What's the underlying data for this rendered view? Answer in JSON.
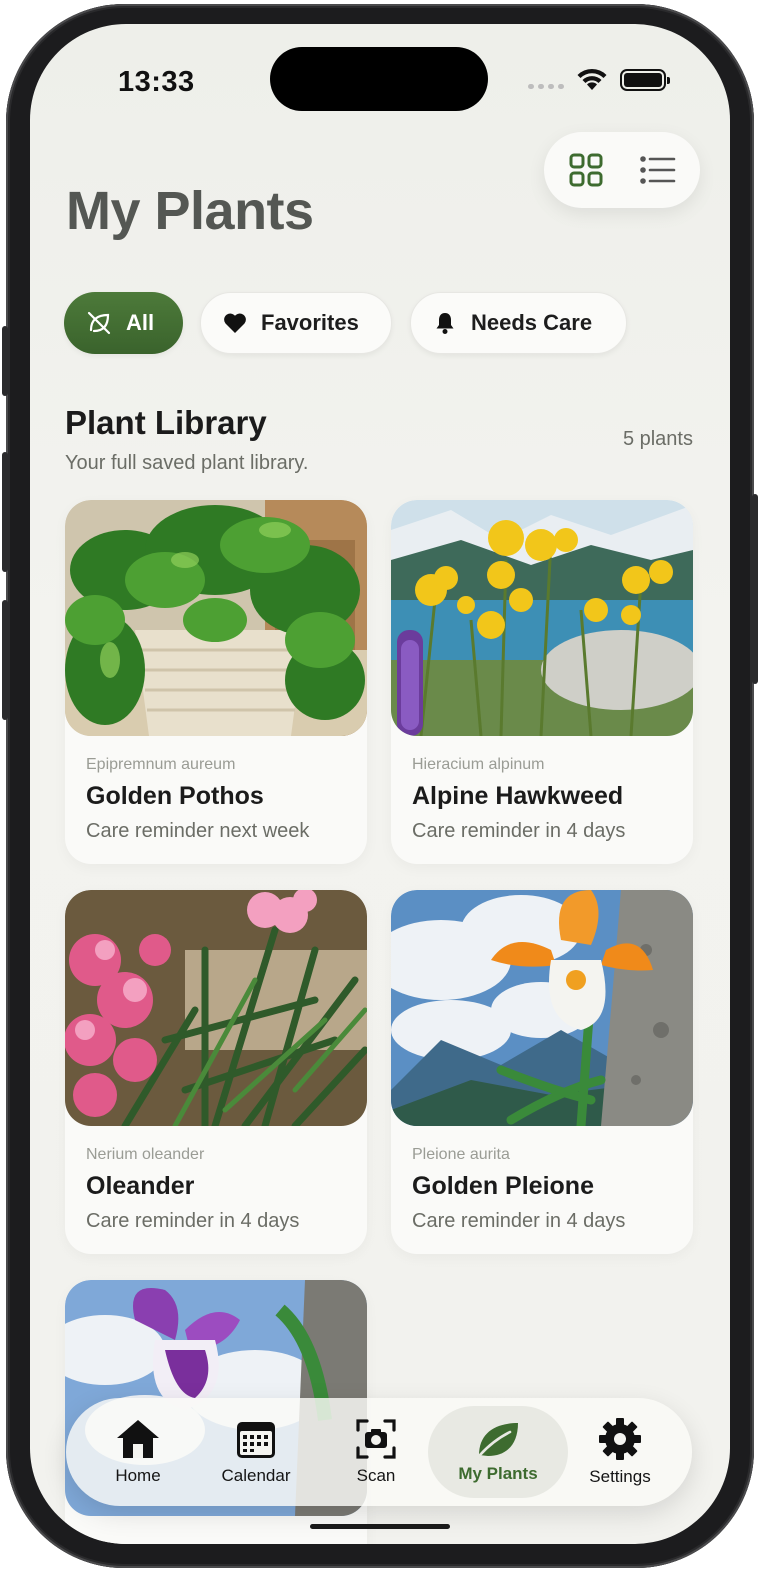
{
  "status_bar": {
    "time": "13:33"
  },
  "header": {
    "title": "My Plants"
  },
  "view_toggle": {
    "selected": "grid"
  },
  "filters": [
    {
      "label": "All",
      "icon": "leaf-slash-icon",
      "active": true
    },
    {
      "label": "Favorites",
      "icon": "heart-icon",
      "active": false
    },
    {
      "label": "Needs Care",
      "icon": "bell-icon",
      "active": false
    }
  ],
  "library": {
    "title": "Plant Library",
    "subtitle": "Your full saved plant library.",
    "count": "5 plants"
  },
  "plants": [
    {
      "scientific": "Epipremnum aureum",
      "name": "Golden Pothos",
      "reminder": "Care reminder next week"
    },
    {
      "scientific": "Hieracium alpinum",
      "name": "Alpine Hawkweed",
      "reminder": "Care reminder in 4 days"
    },
    {
      "scientific": "Nerium oleander",
      "name": "Oleander",
      "reminder": "Care reminder in 4 days"
    },
    {
      "scientific": "Pleione aurita",
      "name": "Golden Pleione",
      "reminder": "Care reminder in 4 days"
    }
  ],
  "nav": [
    {
      "label": "Home",
      "icon": "home-icon"
    },
    {
      "label": "Calendar",
      "icon": "calendar-icon"
    },
    {
      "label": "Scan",
      "icon": "camera-scan-icon"
    },
    {
      "label": "My Plants",
      "icon": "leaf-icon",
      "active": true
    },
    {
      "label": "Settings",
      "icon": "gear-icon"
    }
  ],
  "colors": {
    "accent": "#3d6b2f",
    "background": "#f2f2ee"
  }
}
